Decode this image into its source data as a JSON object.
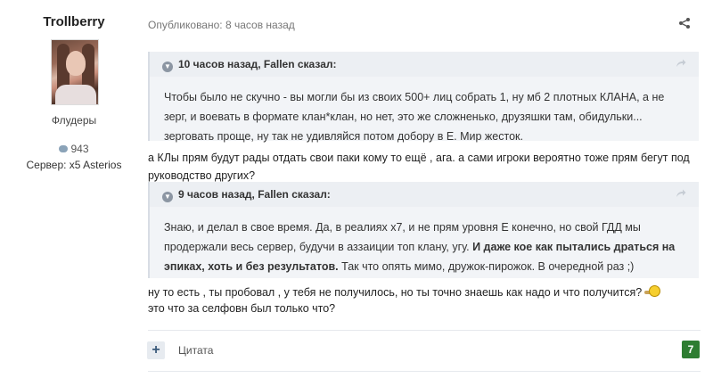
{
  "author": {
    "name": "Trollberry",
    "group": "Флудеры",
    "post_count": "943",
    "server": "Сервер: x5 Asterios"
  },
  "post": {
    "published": "Опубликовано: 8 часов назад",
    "quote1": {
      "header": "10 часов назад, Fallen сказал:",
      "body": "Чтобы было не скучно - вы могли бы из своих 500+ лиц собрать 1, ну мб 2 плотных КЛАНА, а не зерг, и воевать в формате клан*клан, но нет, это же сложненько, друзяшки там, обидульки... зерговать проще, ну так не удивляйся потом добору в Е. Мир жесток."
    },
    "reply1": "а КЛы прям будут рады отдать свои паки кому то ещё , ага. а сами игроки вероятно тоже прям бегут под руководство других?",
    "quote2": {
      "header": "9 часов назад, Fallen сказал:",
      "body_a": "Знаю, и делал в свое время. Да, в реалиях х7, и не прям уровня Е конечно, но свой ГДД мы продержали весь сервер, будучи в аззаиции топ клану, угу. ",
      "body_b": "И даже кое как пытались драться на эпиках, хоть и без результатов.",
      "body_c": " Так что опять мимо, дружок-пирожок. В очередной раз ;)"
    },
    "reply2": "ну то есть , ты пробовал , у тебя не получилось, но ты точно знаешь как надо и что получится?",
    "reply3": "это что за селфовн был только что?"
  },
  "footer": {
    "add_label": "+",
    "quote_label": "Цитата",
    "reputation": "7"
  },
  "colors": {
    "reputation_bg": "#2e7d32",
    "quote_bg": "#f2f4f7"
  }
}
